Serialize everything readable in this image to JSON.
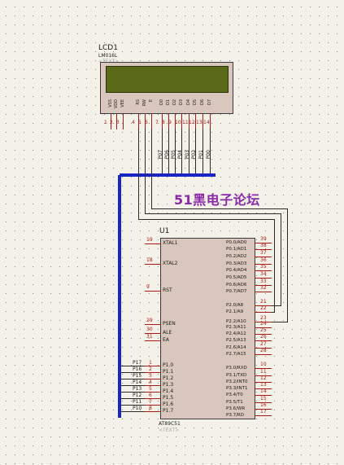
{
  "watermark": "51黑电子论坛",
  "lcd": {
    "ref": "LCD1",
    "model": "LM016L",
    "text_tag": "<TEXT>",
    "pin_names": [
      "VSS",
      "VDD",
      "VEE",
      "RS",
      "RW",
      "E",
      "D0",
      "D1",
      "D2",
      "D3",
      "D4",
      "D5",
      "D6",
      "D7"
    ],
    "pin_numbers": [
      "1",
      "2",
      "3",
      "4",
      "5",
      "6",
      "7",
      "8",
      "9",
      "10",
      "11",
      "12",
      "13",
      "14"
    ],
    "net_labels": [
      "P07",
      "P06",
      "P05",
      "P04",
      "P03",
      "P02",
      "P01",
      "P00"
    ]
  },
  "mcu": {
    "ref": "U1",
    "part": "AT89C51",
    "text_tag": "<TEXT>",
    "left_pins": [
      {
        "num": "19",
        "name": "XTAL1"
      },
      {
        "num": "18",
        "name": "XTAL2"
      },
      {
        "num": "9",
        "name": "RST"
      },
      {
        "num": "29",
        "name": "PSEN"
      },
      {
        "num": "30",
        "name": "ALE"
      },
      {
        "num": "31",
        "name": "EA"
      }
    ],
    "p1_pins": [
      {
        "num": "1",
        "name": "P1.0",
        "net": "P17"
      },
      {
        "num": "2",
        "name": "P1.1",
        "net": "P16"
      },
      {
        "num": "3",
        "name": "P1.2",
        "net": "P15"
      },
      {
        "num": "4",
        "name": "P1.3",
        "net": "P14"
      },
      {
        "num": "5",
        "name": "P1.4",
        "net": "P13"
      },
      {
        "num": "6",
        "name": "P1.5",
        "net": "P12"
      },
      {
        "num": "7",
        "name": "P1.6",
        "net": "P11"
      },
      {
        "num": "8",
        "name": "P1.7",
        "net": "P10"
      }
    ],
    "p0_pins": [
      {
        "num": "39",
        "name": "P0.0/AD0"
      },
      {
        "num": "38",
        "name": "P0.1/AD1"
      },
      {
        "num": "37",
        "name": "P0.2/AD2"
      },
      {
        "num": "36",
        "name": "P0.3/AD3"
      },
      {
        "num": "35",
        "name": "P0.4/AD4"
      },
      {
        "num": "34",
        "name": "P0.5/AD5"
      },
      {
        "num": "33",
        "name": "P0.6/AD6"
      },
      {
        "num": "32",
        "name": "P0.7/AD7"
      }
    ],
    "p2_pins": [
      {
        "num": "21",
        "name": "P2.0/A8"
      },
      {
        "num": "22",
        "name": "P2.1/A9"
      },
      {
        "num": "23",
        "name": "P2.2/A10"
      },
      {
        "num": "24",
        "name": "P2.3/A11"
      },
      {
        "num": "25",
        "name": "P2.4/A12"
      },
      {
        "num": "26",
        "name": "P2.5/A13"
      },
      {
        "num": "27",
        "name": "P2.6/A14"
      },
      {
        "num": "28",
        "name": "P2.7/A15"
      }
    ],
    "p3_pins": [
      {
        "num": "10",
        "name": "P3.0/RXD"
      },
      {
        "num": "11",
        "name": "P3.1/TXD"
      },
      {
        "num": "12",
        "name": "P3.2/INT0"
      },
      {
        "num": "13",
        "name": "P3.3/INT1"
      },
      {
        "num": "14",
        "name": "P3.4/T0"
      },
      {
        "num": "15",
        "name": "P3.5/T1"
      },
      {
        "num": "16",
        "name": "P3.6/WR"
      },
      {
        "num": "17",
        "name": "P3.7/RD"
      }
    ]
  },
  "colors": {
    "background": "#f4f1e8",
    "bus": "#1a25c8",
    "component_fill": "#d9c6bc",
    "lcd_screen": "#5a6a18",
    "pin": "#b01818",
    "watermark": "#8a2aa8"
  }
}
